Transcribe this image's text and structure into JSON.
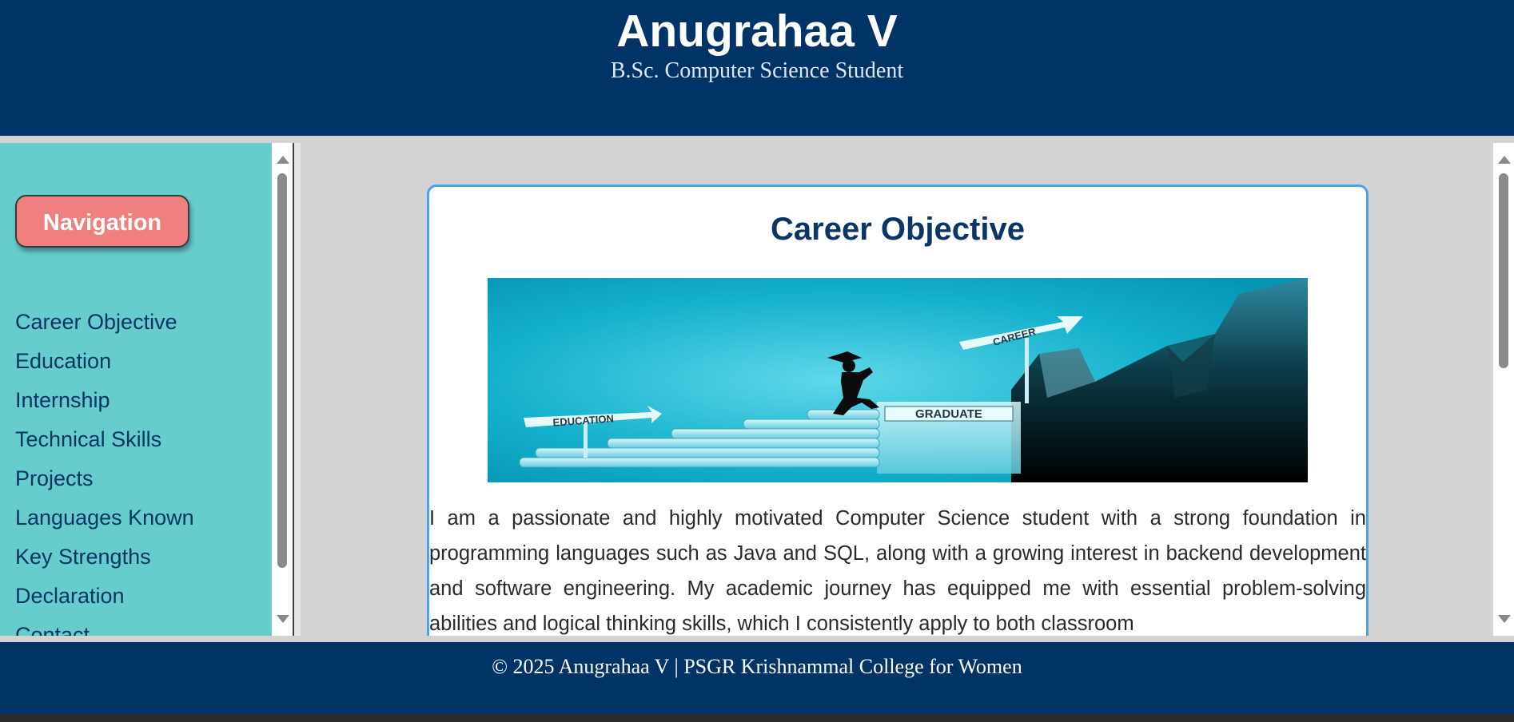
{
  "header": {
    "title": "Anugrahaa V",
    "subtitle": "B.Sc. Computer Science Student"
  },
  "sidebar": {
    "nav_button": "Navigation",
    "items": [
      {
        "label": "Career Objective"
      },
      {
        "label": "Education"
      },
      {
        "label": "Internship"
      },
      {
        "label": "Technical Skills"
      },
      {
        "label": "Projects"
      },
      {
        "label": "Languages Known"
      },
      {
        "label": "Key Strengths"
      },
      {
        "label": "Declaration"
      },
      {
        "label": "Contact"
      }
    ]
  },
  "main": {
    "section_title": "Career Objective",
    "banner": {
      "education_sign": "EDUCATION",
      "graduate_sign": "GRADUATE",
      "career_sign": "CAREER"
    },
    "paragraph": "I am a passionate and highly motivated Computer Science student with a strong foundation in programming languages such as Java and SQL, along with a growing interest in backend development and software engineering. My academic journey has equipped me with essential problem-solving abilities and logical thinking skills, which I consistently apply to both classroom"
  },
  "footer": {
    "text": "© 2025 Anugrahaa V | PSGR Krishnammal College for Women"
  },
  "colors": {
    "header_bg": "#003366",
    "sidebar_bg": "#66cccc",
    "nav_button_bg": "#f08080",
    "main_bg": "#d3d3d3",
    "card_border": "#4aa3f0",
    "title_color": "#0a3566"
  }
}
